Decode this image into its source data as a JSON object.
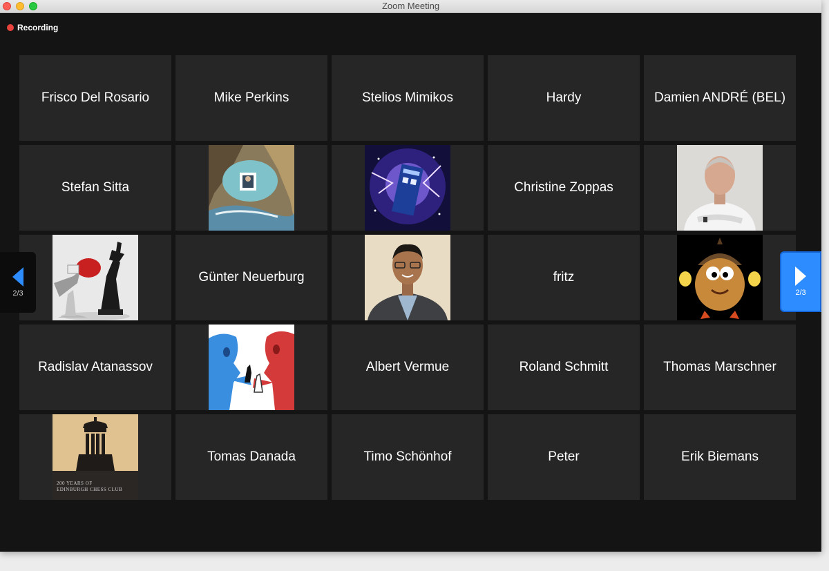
{
  "window": {
    "title": "Zoom Meeting"
  },
  "recording": {
    "label": "Recording"
  },
  "participants": [
    {
      "name": "Frisco Del Rosario"
    },
    {
      "name": "Mike Perkins"
    },
    {
      "name": "Stelios Mimikos"
    },
    {
      "name": "Hardy"
    },
    {
      "name": "Damien ANDRÉ (BEL)"
    },
    {
      "name": "Stefan Sitta"
    },
    {
      "avatar": "cave-portrait-photo"
    },
    {
      "avatar": "police-box-galaxy-image"
    },
    {
      "name": "Christine Zoppas"
    },
    {
      "avatar": "man-portrait-photo"
    },
    {
      "avatar": "chess-boxing-glove-image"
    },
    {
      "name": "Günter Neuerburg"
    },
    {
      "avatar": "man-glasses-portrait-photo"
    },
    {
      "name": "fritz"
    },
    {
      "avatar": "acorn-cartoon-image"
    },
    {
      "name": "Radislav Atanassov"
    },
    {
      "avatar": "chess-handshake-cartoon-image"
    },
    {
      "name": "Albert Vermue"
    },
    {
      "name": "Roland Schmitt"
    },
    {
      "name": "Thomas Marschner"
    },
    {
      "avatar": "chess-club-logo-image",
      "caption_line1": "200 YEARS OF",
      "caption_line2": "EDINBURGH CHESS CLUB"
    },
    {
      "name": "Tomas Danada"
    },
    {
      "name": "Timo Schönhof"
    },
    {
      "name": "Peter"
    },
    {
      "name": "Erik Biemans"
    }
  ],
  "pager": {
    "left_label": "2/3",
    "right_label": "2/3"
  },
  "colors": {
    "accent": "#2d8cff",
    "recording": "#e8433d",
    "tile": "#262626",
    "background": "#141414"
  }
}
